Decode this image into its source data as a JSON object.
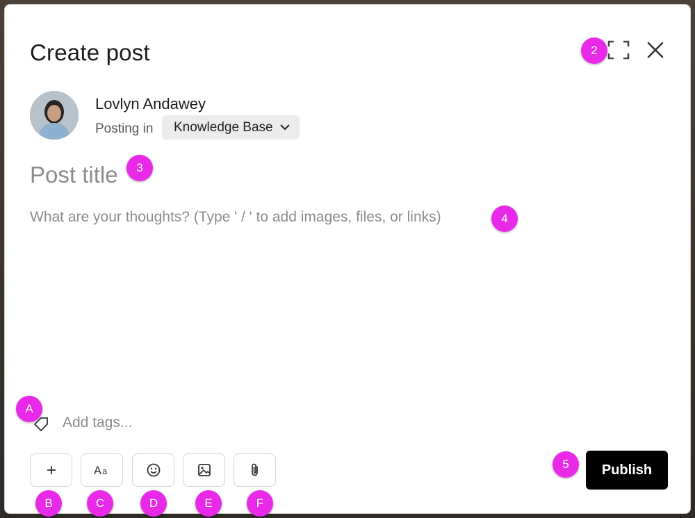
{
  "dialog": {
    "title": "Create post"
  },
  "author": {
    "name": "Lovlyn Andawey",
    "posting_in_label": "Posting in",
    "space": "Knowledge Base"
  },
  "editor": {
    "title_placeholder": "Post title",
    "body_placeholder": "What are your thoughts? (Type ' / ' to add images, files, or links)",
    "tags_placeholder": "Add tags..."
  },
  "toolbar": {
    "items": [
      {
        "name": "add-button",
        "icon": "plus-icon"
      },
      {
        "name": "text-format-button",
        "icon": "text-format-icon"
      },
      {
        "name": "emoji-button",
        "icon": "smiley-icon"
      },
      {
        "name": "image-button",
        "icon": "image-icon"
      },
      {
        "name": "attachment-button",
        "icon": "paperclip-icon"
      }
    ]
  },
  "actions": {
    "publish_label": "Publish"
  },
  "markers": {
    "m2": "2",
    "m3": "3",
    "m4": "4",
    "m5": "5",
    "mA": "A",
    "mB": "B",
    "mC": "C",
    "mD": "D",
    "mE": "E",
    "mF": "F"
  },
  "colors": {
    "marker": "#e829e8",
    "publish_bg": "#000000",
    "placeholder": "#8c8c8c"
  }
}
